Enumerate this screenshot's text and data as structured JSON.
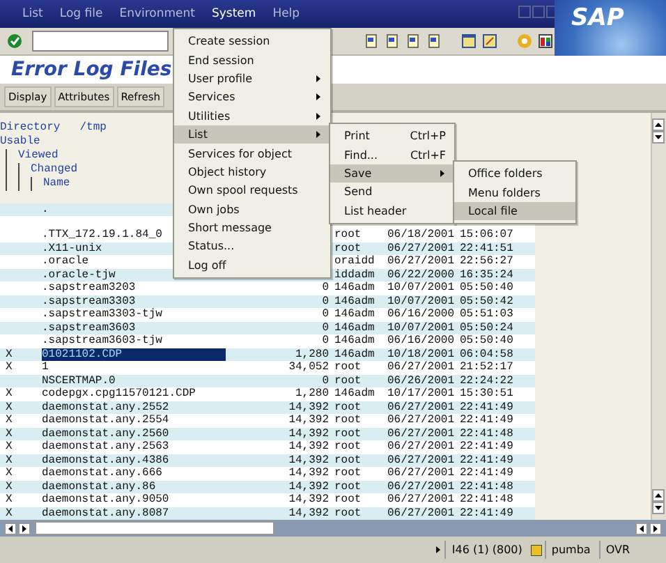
{
  "menu_bar": [
    {
      "label": "List",
      "selected": false
    },
    {
      "label": "Log file",
      "selected": false
    },
    {
      "label": "Environment",
      "selected": false
    },
    {
      "label": "System",
      "selected": true
    },
    {
      "label": "Help",
      "selected": false
    }
  ],
  "logo": "SAP",
  "title": "Error Log Files",
  "app_toolbar": [
    "Display",
    "Attributes",
    "Refresh"
  ],
  "list_header": {
    "directory_label": "Directory",
    "directory": "/tmp",
    "columns": [
      "Usable",
      "Viewed",
      "Changed",
      "Name"
    ]
  },
  "rows": [
    {
      "name": ".",
      "selected": false
    },
    {
      "name": ".TTX_172.19.1.84_0",
      "owner": "root",
      "date": "06/18/2001",
      "time": "15:06:07",
      "selected": false
    },
    {
      "name": ".X11-unix",
      "owner": "root",
      "date": "06/27/2001",
      "time": "22:41:51",
      "selected": false
    },
    {
      "name": ".oracle",
      "owner": "oraidd",
      "date": "06/27/2001",
      "time": "22:56:27",
      "selected": false
    },
    {
      "name": ".oracle-tjw",
      "owner": "iddadm",
      "date": "06/22/2000",
      "time": "16:35:24",
      "selected": false
    },
    {
      "name": ".sapstream3203",
      "size": "0",
      "owner": "146adm",
      "date": "10/07/2001",
      "time": "05:50:40",
      "selected": false
    },
    {
      "name": ".sapstream3303",
      "size": "0",
      "owner": "146adm",
      "date": "10/07/2001",
      "time": "05:50:42",
      "selected": false
    },
    {
      "name": ".sapstream3303-tjw",
      "size": "0",
      "owner": "146adm",
      "date": "06/16/2000",
      "time": "05:51:03",
      "selected": false
    },
    {
      "name": ".sapstream3603",
      "size": "0",
      "owner": "146adm",
      "date": "10/07/2001",
      "time": "05:50:24",
      "selected": false
    },
    {
      "name": ".sapstream3603-tjw",
      "size": "0",
      "owner": "146adm",
      "date": "06/16/2000",
      "time": "05:50:40",
      "selected": false
    },
    {
      "mark": "X",
      "name": "01021102.CDP",
      "size": "1,280",
      "owner": "146adm",
      "date": "10/18/2001",
      "time": "06:04:58",
      "selected": true
    },
    {
      "mark": "X",
      "name": "1",
      "size": "34,052",
      "owner": "root",
      "date": "06/27/2001",
      "time": "21:52:17",
      "selected": false
    },
    {
      "name": "NSCERTMAP.0",
      "size": "0",
      "owner": "root",
      "date": "06/26/2001",
      "time": "22:24:22",
      "selected": false
    },
    {
      "mark": "X",
      "name": "codepgx.cpg11570121.CDP",
      "size": "1,280",
      "owner": "146adm",
      "date": "10/17/2001",
      "time": "15:30:51",
      "selected": false
    },
    {
      "mark": "X",
      "name": "daemonstat.any.2552",
      "size": "14,392",
      "owner": "root",
      "date": "06/27/2001",
      "time": "22:41:49",
      "selected": false
    },
    {
      "mark": "X",
      "name": "daemonstat.any.2554",
      "size": "14,392",
      "owner": "root",
      "date": "06/27/2001",
      "time": "22:41:49",
      "selected": false
    },
    {
      "mark": "X",
      "name": "daemonstat.any.2560",
      "size": "14,392",
      "owner": "root",
      "date": "06/27/2001",
      "time": "22:41:48",
      "selected": false
    },
    {
      "mark": "X",
      "name": "daemonstat.any.2563",
      "size": "14,392",
      "owner": "root",
      "date": "06/27/2001",
      "time": "22:41:49",
      "selected": false
    },
    {
      "mark": "X",
      "name": "daemonstat.any.4386",
      "size": "14,392",
      "owner": "root",
      "date": "06/27/2001",
      "time": "22:41:49",
      "selected": false
    },
    {
      "mark": "X",
      "name": "daemonstat.any.666",
      "size": "14,392",
      "owner": "root",
      "date": "06/27/2001",
      "time": "22:41:49",
      "selected": false
    },
    {
      "mark": "X",
      "name": "daemonstat.any.86",
      "size": "14,392",
      "owner": "root",
      "date": "06/27/2001",
      "time": "22:41:48",
      "selected": false
    },
    {
      "mark": "X",
      "name": "daemonstat.any.9050",
      "size": "14,392",
      "owner": "root",
      "date": "06/27/2001",
      "time": "22:41:48",
      "selected": false
    },
    {
      "mark": "X",
      "name": "daemonstat.any.8087",
      "size": "14,392",
      "owner": "root",
      "date": "06/27/2001",
      "time": "22:41:49",
      "selected": false
    }
  ],
  "system_menu": [
    {
      "label": "Create session",
      "submenu": false,
      "selected": false
    },
    {
      "label": "End session",
      "submenu": false,
      "selected": false
    },
    {
      "label": "User profile",
      "submenu": true,
      "selected": false
    },
    {
      "label": "Services",
      "submenu": true,
      "selected": false
    },
    {
      "label": "Utilities",
      "submenu": true,
      "selected": false
    },
    {
      "label": "List",
      "submenu": true,
      "selected": true
    },
    {
      "label": "Services for object",
      "submenu": false,
      "selected": false
    },
    {
      "label": "Object history",
      "submenu": false,
      "selected": false
    },
    {
      "label": "Own spool requests",
      "submenu": false,
      "selected": false
    },
    {
      "label": "Own jobs",
      "submenu": false,
      "selected": false
    },
    {
      "label": "Short message",
      "submenu": false,
      "selected": false
    },
    {
      "label": "Status...",
      "submenu": false,
      "selected": false
    },
    {
      "label": "Log off",
      "submenu": false,
      "selected": false
    }
  ],
  "list_menu": [
    {
      "label": "Print",
      "shortcut": "Ctrl+P",
      "submenu": false,
      "selected": false
    },
    {
      "label": "Find...",
      "shortcut": "Ctrl+F",
      "submenu": false,
      "selected": false
    },
    {
      "label": "Save",
      "submenu": true,
      "selected": true
    },
    {
      "label": "Send",
      "submenu": false,
      "selected": false
    },
    {
      "label": "List header",
      "submenu": false,
      "selected": false
    }
  ],
  "save_menu": [
    {
      "label": "Office folders",
      "submenu": false,
      "selected": false
    },
    {
      "label": "Menu folders",
      "submenu": false,
      "selected": false
    },
    {
      "label": "Local file",
      "submenu": false,
      "selected": true
    }
  ],
  "status_bar": {
    "system": "I46 (1) (800)",
    "server": "pumba",
    "mode": "OVR"
  }
}
